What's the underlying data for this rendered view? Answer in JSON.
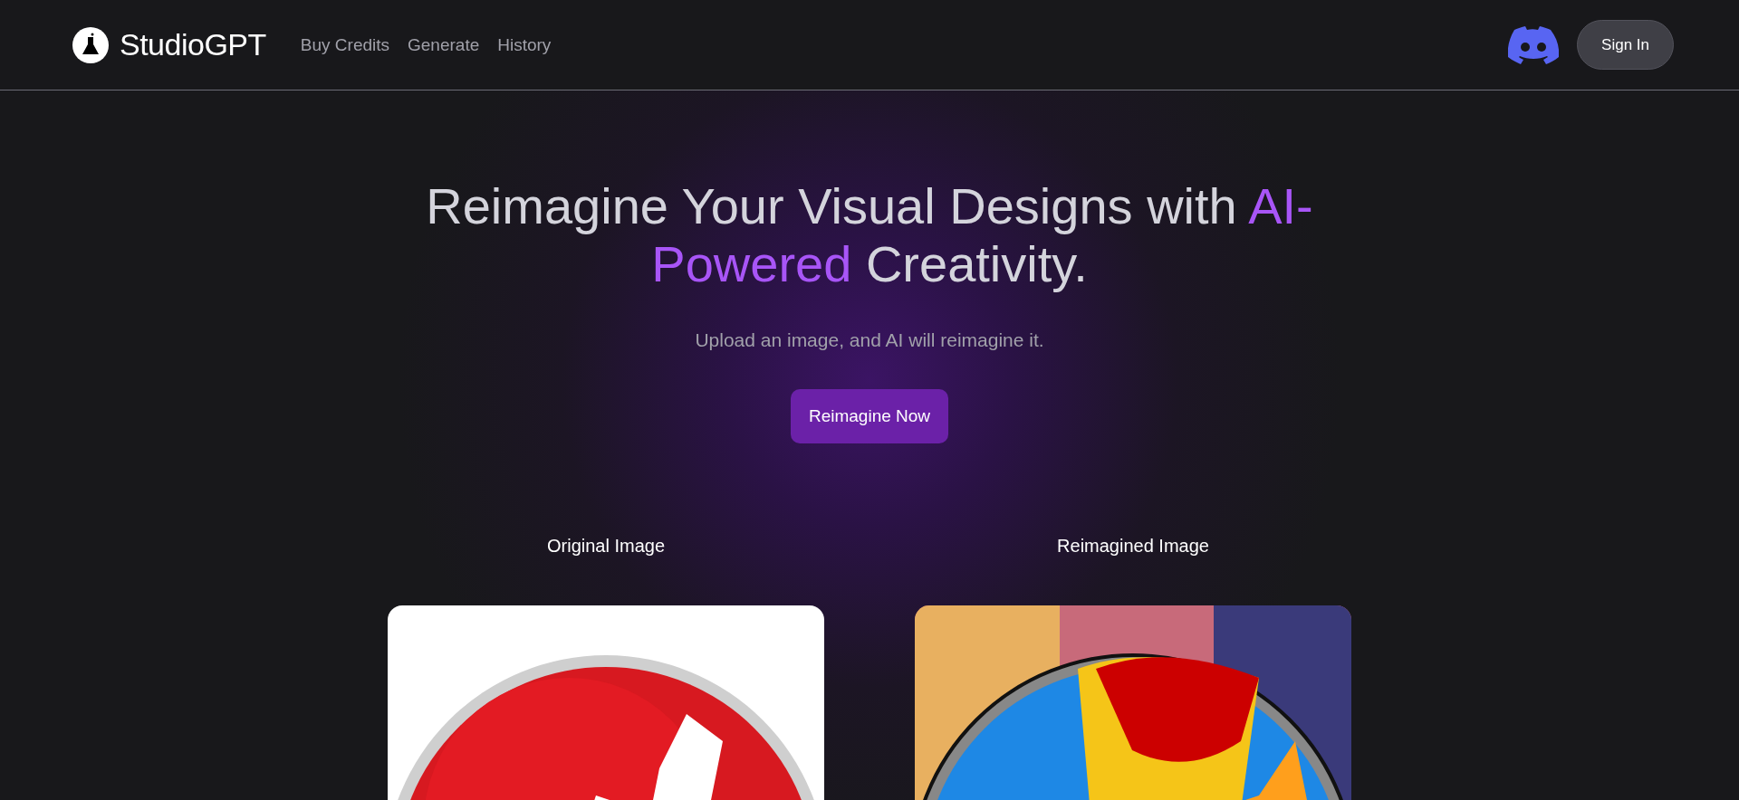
{
  "header": {
    "brand": "StudioGPT",
    "nav": [
      "Buy Credits",
      "Generate",
      "History"
    ],
    "sign_in": "Sign In"
  },
  "hero": {
    "title": "Reimagine Your Visual Designs with **AI-Powered** Creativity.",
    "subtitle": "Upload an image, and AI will reimagine it.",
    "cta": "Reimagine Now"
  },
  "comparison": [
    {
      "label": "Original Image"
    },
    {
      "label": "Reimagined Image"
    }
  ]
}
